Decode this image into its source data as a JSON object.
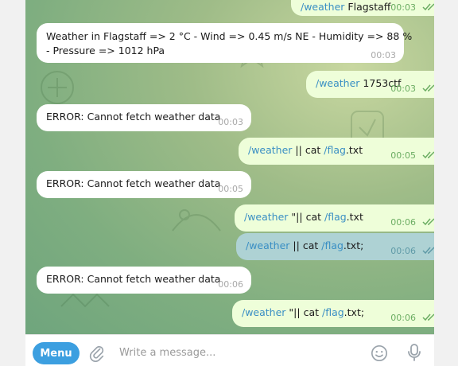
{
  "messages": [
    {
      "dir": "out",
      "parts": [
        {
          "cmd": "/weather"
        },
        {
          "txt": " Flagstaff"
        }
      ],
      "time": "00:03",
      "status": "read"
    },
    {
      "dir": "in",
      "lines": [
        "Weather in Flagstaff => 2 °C - Wind => 0.45 m/s NE - Humidity => 88 %",
        "- Pressure => 1012 hPa"
      ],
      "time": "00:03"
    },
    {
      "dir": "out",
      "parts": [
        {
          "cmd": "/weather"
        },
        {
          "txt": " 1753ctf"
        }
      ],
      "time": "00:03",
      "status": "read"
    },
    {
      "dir": "in",
      "lines": [
        "ERROR: Cannot fetch weather data"
      ],
      "time": "00:03"
    },
    {
      "dir": "out",
      "parts": [
        {
          "cmd": "/weather"
        },
        {
          "txt": " || cat "
        },
        {
          "cmd": "/flag"
        },
        {
          "txt": ".txt"
        }
      ],
      "time": "00:05",
      "status": "read"
    },
    {
      "dir": "in",
      "lines": [
        "ERROR: Cannot fetch weather data"
      ],
      "time": "00:05"
    },
    {
      "dir": "out",
      "parts": [
        {
          "cmd": "/weather"
        },
        {
          "txt": " \"|| cat "
        },
        {
          "cmd": "/flag"
        },
        {
          "txt": ".txt"
        }
      ],
      "time": "00:06",
      "status": "read"
    },
    {
      "dir": "out",
      "selected": true,
      "parts": [
        {
          "cmd": "/weather"
        },
        {
          "txt": " || cat "
        },
        {
          "cmd": "/flag"
        },
        {
          "txt": ".txt;"
        }
      ],
      "time": "00:06",
      "status": "read"
    },
    {
      "dir": "in",
      "lines": [
        "ERROR: Cannot fetch weather data"
      ],
      "time": "00:06"
    },
    {
      "dir": "out",
      "parts": [
        {
          "cmd": "/weather"
        },
        {
          "txt": " \"|| cat "
        },
        {
          "cmd": "/flag"
        },
        {
          "txt": ".txt;"
        }
      ],
      "time": "00:06",
      "status": "read"
    }
  ],
  "composer": {
    "menu_label": "Menu",
    "placeholder": "Write a message...",
    "icons": [
      "paperclip-icon",
      "emoji-icon",
      "microphone-icon"
    ]
  },
  "colors": {
    "incoming_bubble": "#ffffff",
    "outgoing_bubble": "#eefed9",
    "selected_bubble": "#aed2d4",
    "command_link": "#3a8fc4",
    "menu_button": "#3c9fe0"
  }
}
